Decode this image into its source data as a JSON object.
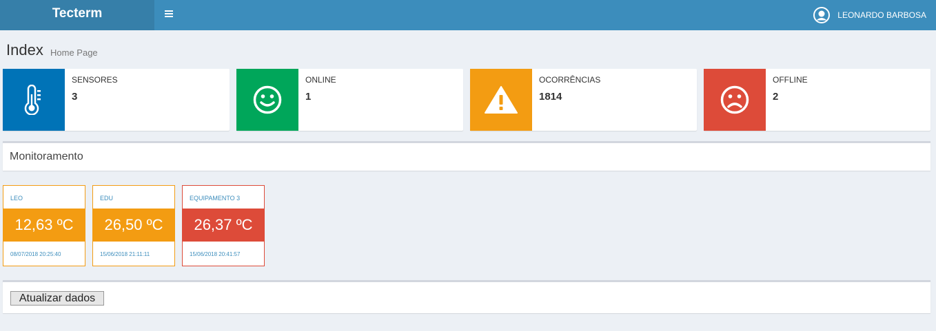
{
  "header": {
    "logo": "Tecterm",
    "menu_icon": "hamburger-icon",
    "user_name": "LEONARDO BARBOSA",
    "user_icon": "user-avatar-icon"
  },
  "content_header": {
    "title": "Index",
    "subtitle": "Home Page"
  },
  "info_boxes": [
    {
      "label": "SENSORES",
      "value": "3",
      "icon": "thermometer-icon",
      "color": "#0073b7"
    },
    {
      "label": "ONLINE",
      "value": "1",
      "icon": "smile-icon",
      "color": "#00a65a"
    },
    {
      "label": "OCORRÊNCIAS",
      "value": "1814",
      "icon": "warning-icon",
      "color": "#f39c12"
    },
    {
      "label": "OFFLINE",
      "value": "2",
      "icon": "frown-icon",
      "color": "#dd4b39"
    }
  ],
  "monitoring": {
    "title": "Monitoramento",
    "devices": [
      {
        "name": "LEO",
        "temperature": "12,63 ºC",
        "timestamp": "08/07/2018 20:25:40",
        "color": "#f39c12"
      },
      {
        "name": "EDU",
        "temperature": "26,50 ºC",
        "timestamp": "15/06/2018 21:11:11",
        "color": "#f39c12"
      },
      {
        "name": "EQUIPAMENTO 3",
        "temperature": "26,37 ºC",
        "timestamp": "15/06/2018 20:41:57",
        "color": "#dd4b39"
      }
    ]
  },
  "actions": {
    "update_label": "Atualizar dados"
  }
}
